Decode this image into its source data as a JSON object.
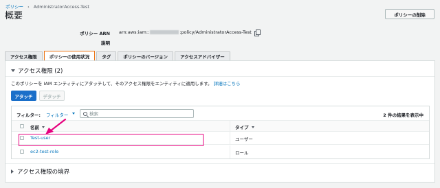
{
  "breadcrumb": {
    "root": "ポリシー",
    "separator": "›",
    "current": "AdministratorAccess-Test"
  },
  "page": {
    "title": "概要",
    "delete_button": "ポリシーの削除"
  },
  "summary": {
    "arn_label": "ポリシー ARN",
    "arn_prefix": "arn:aws:iam::",
    "arn_suffix": ":policy/AdministratorAccess-Test",
    "description_label": "説明",
    "description_value": ""
  },
  "tabs": [
    {
      "label": "アクセス権限",
      "active": false
    },
    {
      "label": "ポリシーの使用状況",
      "active": true
    },
    {
      "label": "タグ",
      "active": false
    },
    {
      "label": "ポリシーのバージョン",
      "active": false
    },
    {
      "label": "アクセスアドバイザー",
      "active": false
    }
  ],
  "permissions": {
    "heading": "アクセス権限 (2)",
    "info_text": "このポリシーを IAM エンティティにアタッチして、そのアクセス権限をエンティティに適用します。",
    "info_link": "詳細はこちら",
    "attach_button": "アタッチ",
    "detach_button": "デタッチ"
  },
  "table": {
    "filter_label": "フィルター:",
    "filter_link": "フィルター",
    "search_placeholder": "検索",
    "result_count": "2 件の結果を表示中",
    "columns": {
      "name": "名前",
      "type": "タイプ"
    },
    "rows": [
      {
        "name": "Test-user",
        "type": "ユーザー"
      },
      {
        "name": "ec2-test-role",
        "type": "ロール"
      }
    ]
  },
  "boundary": {
    "heading": "アクセス権限の境界"
  },
  "colors": {
    "accent": "#ec7211",
    "primary": "#1a6fc9",
    "link": "#0073bb",
    "highlight": "#e6007e"
  }
}
